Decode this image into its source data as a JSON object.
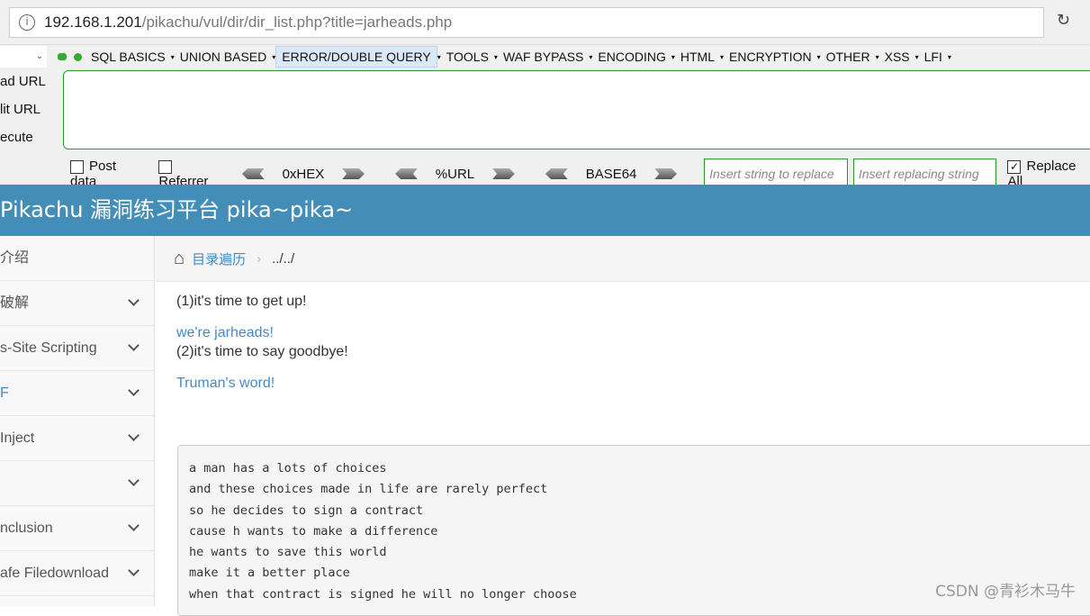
{
  "browser": {
    "url_host": "192.168.1.201",
    "url_path": "/pikachu/vul/dir/dir_list.php?title=jarheads.php"
  },
  "hackbar": {
    "menu": [
      "SQL BASICS",
      "UNION BASED",
      "ERROR/DOUBLE QUERY",
      "TOOLS",
      "WAF BYPASS",
      "ENCODING",
      "HTML",
      "ENCRYPTION",
      "OTHER",
      "XSS",
      "LFI"
    ],
    "active_menu": "ERROR/DOUBLE QUERY",
    "side_buttons": [
      "ad URL",
      "lit URL",
      "ecute"
    ],
    "post_data": "Post data",
    "referrer": "Referrer",
    "hex": "0xHEX",
    "url": "%URL",
    "base64": "BASE64",
    "replace_placeholder": "Insert string to replace",
    "replacing_placeholder": "Insert replacing string",
    "replace_all": "Replace All",
    "replace_all_checked": true
  },
  "site": {
    "title": "Pikachu 漏洞练习平台 pika~pika~"
  },
  "sidebar": {
    "items": [
      "介绍",
      "破解",
      "s-Site Scripting",
      "F",
      "Inject",
      "",
      "nclusion",
      "afe Filedownload"
    ]
  },
  "breadcrumb": {
    "link": "目录遍历",
    "current": "../../"
  },
  "content": {
    "line1": "(1)it's time to get up!",
    "link1": "we're jarheads!",
    "line2": "(2)it's time to say goodbye!",
    "link2": "Truman's word!",
    "poem": [
      "a man has a lots of choices",
      "and these choices made in life are rarely perfect",
      "so he decides to sign a contract",
      "cause h wants to make a difference",
      "he wants to save this world",
      "make it a better place",
      "when that contract is signed he will no longer choose"
    ]
  },
  "watermark": "CSDN @青衫木马牛"
}
